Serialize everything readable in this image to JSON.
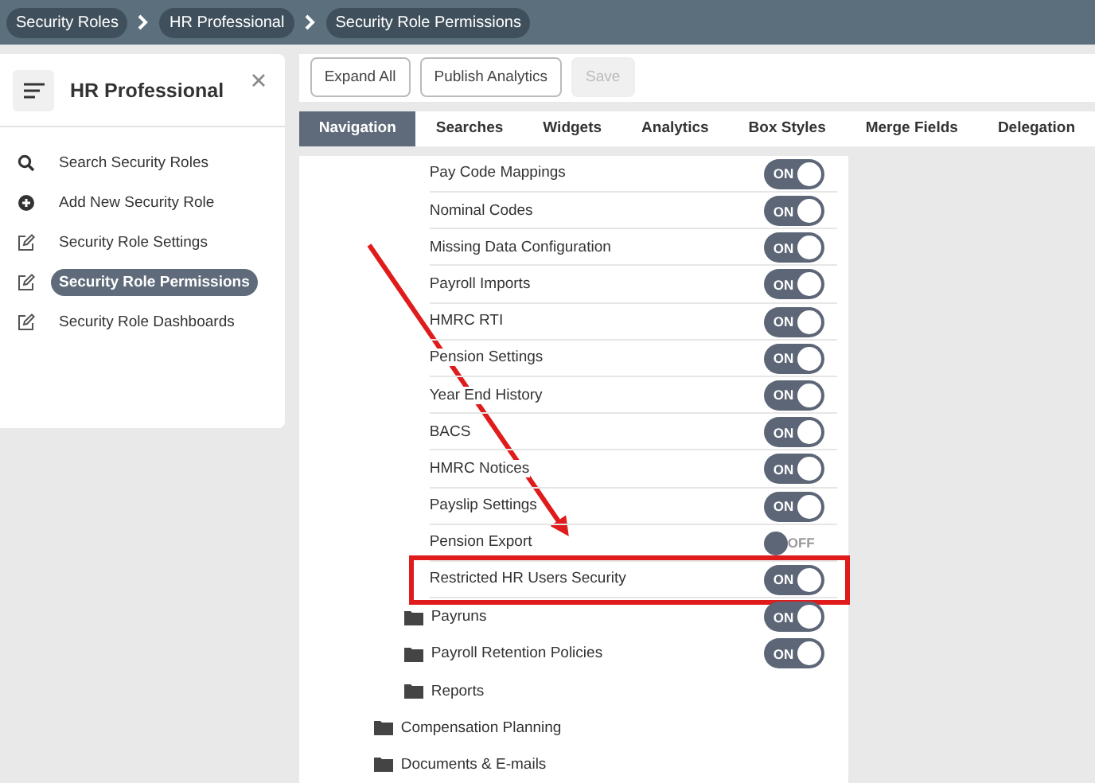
{
  "breadcrumbs": [
    {
      "label": "Security Roles"
    },
    {
      "label": "HR Professional"
    },
    {
      "label": "Security Role Permissions"
    }
  ],
  "sidebar": {
    "title": "HR Professional",
    "items": [
      {
        "label": "Search Security Roles",
        "kind": "search",
        "selected": false
      },
      {
        "label": "Add New Security Role",
        "kind": "add",
        "selected": false
      },
      {
        "label": "Security Role Settings",
        "kind": "edit",
        "selected": false
      },
      {
        "label": "Security Role Permissions",
        "kind": "edit",
        "selected": true
      },
      {
        "label": "Security Role Dashboards",
        "kind": "edit",
        "selected": false
      }
    ]
  },
  "toolbar": {
    "buttons": [
      {
        "label": "Expand All",
        "disabled": false
      },
      {
        "label": "Publish Analytics",
        "disabled": false
      },
      {
        "label": "Save",
        "disabled": true
      }
    ]
  },
  "tabs": [
    {
      "label": "Navigation",
      "selected": true
    },
    {
      "label": "Searches",
      "selected": false
    },
    {
      "label": "Widgets",
      "selected": false
    },
    {
      "label": "Analytics",
      "selected": false
    },
    {
      "label": "Box Styles",
      "selected": false
    },
    {
      "label": "Merge Fields",
      "selected": false
    },
    {
      "label": "Delegation",
      "selected": false
    }
  ],
  "tree": [
    {
      "kind": "group",
      "children": [
        {
          "kind": "group",
          "children": [
            {
              "kind": "page",
              "label": "Pay Code Mappings",
              "on": true,
              "toggle_label": "ON"
            },
            {
              "kind": "page",
              "label": "Nominal Codes",
              "on": true,
              "toggle_label": "ON"
            },
            {
              "kind": "page",
              "label": "Missing Data Configuration",
              "on": true,
              "toggle_label": "ON"
            },
            {
              "kind": "page",
              "label": "Payroll Imports",
              "on": true,
              "toggle_label": "ON"
            },
            {
              "kind": "page",
              "label": "HMRC RTI",
              "on": true,
              "toggle_label": "ON"
            },
            {
              "kind": "page",
              "label": "Pension Settings",
              "on": true,
              "toggle_label": "ON"
            },
            {
              "kind": "page",
              "label": "Year End History",
              "on": true,
              "toggle_label": "ON"
            },
            {
              "kind": "page",
              "label": "BACS",
              "on": true,
              "toggle_label": "ON"
            },
            {
              "kind": "page",
              "label": "HMRC Notices",
              "on": true,
              "toggle_label": "ON"
            },
            {
              "kind": "page",
              "label": "Payslip Settings",
              "on": true,
              "toggle_label": "ON"
            },
            {
              "kind": "page",
              "label": "Pension Export",
              "on": false,
              "toggle_label": "OFF"
            },
            {
              "kind": "page",
              "label": "Restricted HR Users Security",
              "on": true,
              "toggle_label": "ON",
              "highlighted": true
            }
          ]
        },
        {
          "kind": "folder",
          "label": "Payruns",
          "on": true,
          "toggle_label": "ON"
        },
        {
          "kind": "folder",
          "label": "Payroll Retention Policies",
          "on": true,
          "toggle_label": "ON"
        },
        {
          "kind": "folder",
          "label": "Reports"
        }
      ]
    },
    {
      "kind": "folder",
      "label": "Compensation Planning"
    },
    {
      "kind": "folder",
      "label": "Documents & E-mails"
    }
  ]
}
